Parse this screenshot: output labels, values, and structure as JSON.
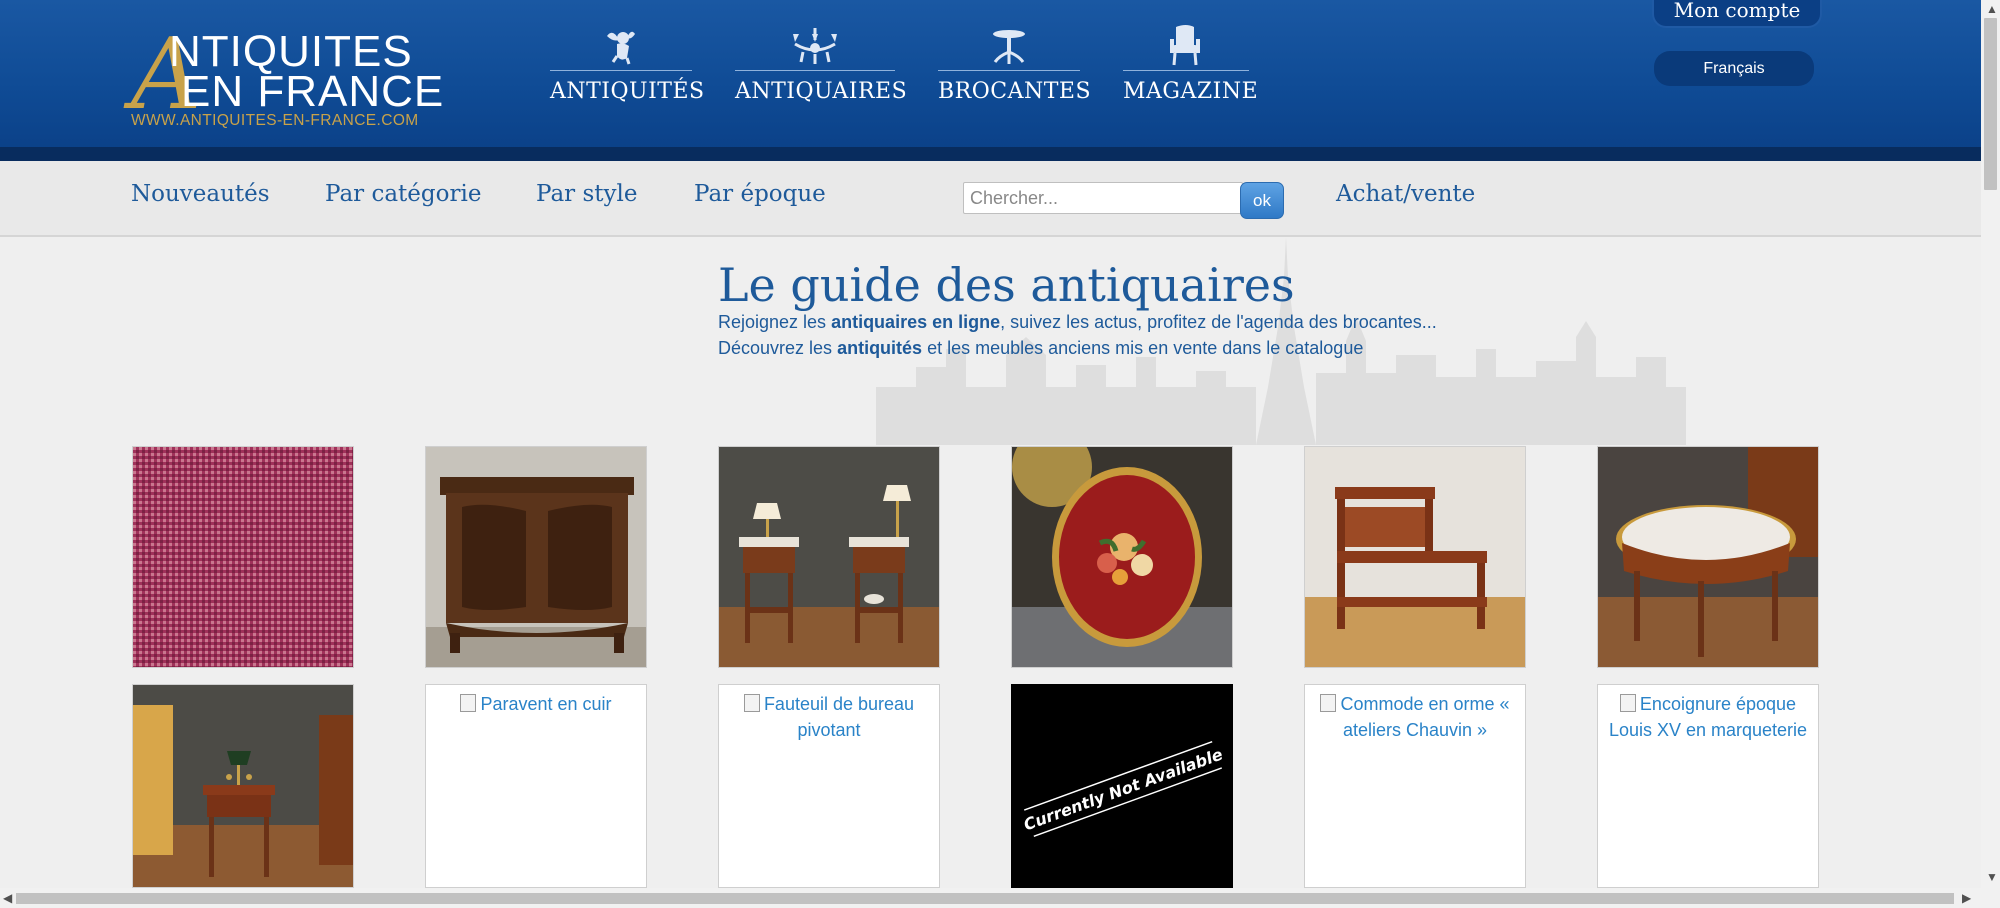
{
  "logo": {
    "big_letter": "A",
    "line1": "NTIQUITES",
    "line2": "EN FRANCE",
    "url": "WWW.ANTIQUITES-EN-FRANCE.COM"
  },
  "nav": [
    {
      "label": "ANTIQUITÉS",
      "icon": "cherub-icon"
    },
    {
      "label": "ANTIQUAIRES",
      "icon": "chandelier-icon"
    },
    {
      "label": "BROCANTES",
      "icon": "gueridon-table-icon"
    },
    {
      "label": "MAGAZINE",
      "icon": "armchair-icon"
    }
  ],
  "account": {
    "label": "Mon compte"
  },
  "language": {
    "label": "Français"
  },
  "subnav": {
    "items": [
      "Nouveautés",
      "Par catégorie",
      "Par style",
      "Par époque"
    ],
    "search_placeholder": "Chercher...",
    "ok_label": "ok",
    "extra": "Achat/vente"
  },
  "main": {
    "title": "Le guide des antiquaires",
    "intro": {
      "line1_pre": "Rejoignez les ",
      "line1_bold": "antiquaires en ligne",
      "line1_post": ", suivez les actus, profitez de l'agenda des brocantes...",
      "line2_pre": "Découvrez les ",
      "line2_bold": "antiquités",
      "line2_post": " et les meubles anciens mis en vente dans le catalogue"
    }
  },
  "products": [
    {
      "kind": "image",
      "icon": "red-fabric-photo"
    },
    {
      "kind": "image",
      "icon": "walnut-buffet-photo"
    },
    {
      "kind": "image",
      "icon": "bedside-tables-photo"
    },
    {
      "kind": "image",
      "icon": "painted-tray-photo"
    },
    {
      "kind": "image",
      "icon": "library-steps-photo"
    },
    {
      "kind": "image",
      "icon": "marble-table-photo"
    },
    {
      "kind": "image",
      "icon": "side-table-photo"
    },
    {
      "kind": "alt",
      "alt": "Paravent en cuir"
    },
    {
      "kind": "alt",
      "alt": "Fauteuil de bureau pivotant"
    },
    {
      "kind": "unavailable",
      "text": "Currently Not Available"
    },
    {
      "kind": "alt",
      "alt": "Commode en orme « ateliers Chauvin »"
    },
    {
      "kind": "alt",
      "alt": "Encoignure époque Louis XV en marqueterie"
    }
  ],
  "colors": {
    "header_blue": "#0f4b95",
    "gold": "#c8a24a",
    "link_blue": "#1e5a9a",
    "alt_text_blue": "#2a83c8"
  }
}
